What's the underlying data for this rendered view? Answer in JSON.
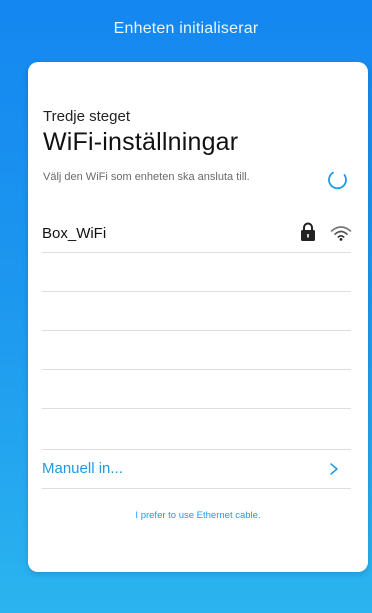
{
  "header": {
    "title": "Enheten initialiserar"
  },
  "card": {
    "step_label": "Tredje steget",
    "title": "WiFi-inställningar",
    "description": "Välj den WiFi som enheten ska ansluta till.",
    "networks": [
      {
        "name": "Box_WiFi",
        "secured": true,
        "icons": [
          "lock-icon",
          "wifi-icon"
        ]
      }
    ],
    "manual_label": "Manuell in...",
    "ethernet_link": "I prefer to use Ethernet cable."
  },
  "colors": {
    "accent": "#1b9be8",
    "background_top": "#1487f0",
    "background_bottom": "#2bb4ef"
  }
}
